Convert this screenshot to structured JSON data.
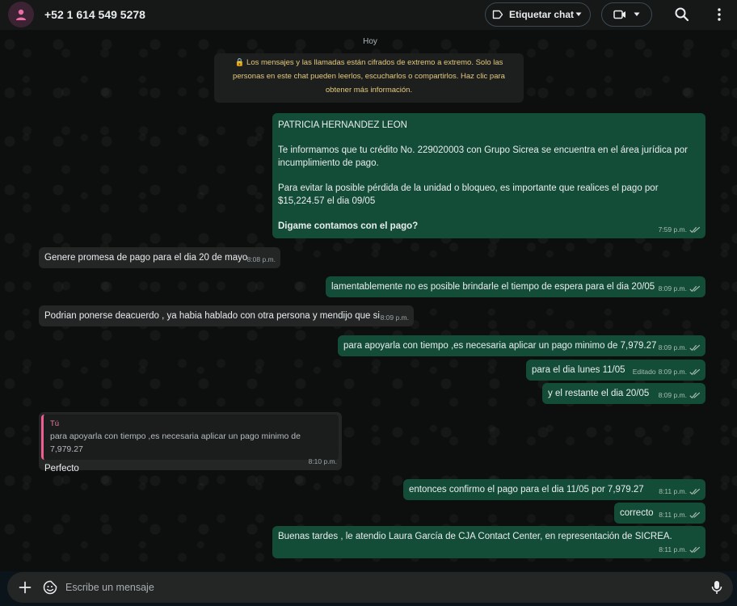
{
  "header": {
    "contact_name": "+52 1 614 549 5278",
    "label_button": "Etiquetar chat",
    "icons": [
      "person-icon",
      "label-icon",
      "chevron-down-icon",
      "video-camera-icon",
      "search-icon",
      "kebab-menu-icon"
    ]
  },
  "chat": {
    "day_chip": "Hoy",
    "encryption_notice": "🔒 Los mensajes y las llamadas están cifrados de extremo a extremo. Solo las personas en este chat pueden leerlos, escucharlos o compartirlos. Haz clic para obtener más información.",
    "messages": [
      {
        "direction": "out",
        "paragraphs": [
          "PATRICIA HERNANDEZ LEON",
          "Te informamos que tu crédito No. 229020003 con Grupo Sicrea se encuentra en el área jurídica por incumplimiento de pago.",
          "Para evitar la posible pérdida de la unidad o bloqueo, es importante que realices el pago  por $15,224.57 el dia 09/05",
          "Digame contamos con el pago?"
        ],
        "time": "7:59 p.m."
      },
      {
        "direction": "in",
        "text": "Genere promesa de pago para el dia 20 de mayo",
        "time": "8:08 p.m."
      },
      {
        "direction": "out",
        "text": "lamentablemente no es posible brindarle el tiempo de espera para el dia 20/05",
        "time": "8:09 p.m."
      },
      {
        "direction": "in",
        "text": "Podrian ponerse deacuerdo , ya habia hablado con otra persona y mendijo que si",
        "time": "8:09 p.m."
      },
      {
        "direction": "out",
        "text": "para apoyarla con tiempo ,es necesaria aplicar un pago minimo de 7,979.27",
        "time": "8:09 p.m."
      },
      {
        "direction": "out",
        "text": "para el dia lunes 11/05",
        "edited": "Editado",
        "time": "8:09 p.m."
      },
      {
        "direction": "out",
        "text": "y el restante  el dia  20/05",
        "time": "8:09 p.m."
      },
      {
        "direction": "in",
        "quote_author": "Tú",
        "quote_text": "para apoyarla con tiempo ,es necesaria aplicar un pago minimo de 7,979.27",
        "text": "Perfecto",
        "time": "8:10 p.m."
      },
      {
        "direction": "out",
        "text": "entonces confirmo el pago para el dia  11/05  por   7,979.27",
        "time": "8:11 p.m."
      },
      {
        "direction": "out",
        "text": "correcto",
        "time": "8:11 p.m."
      },
      {
        "direction": "out",
        "text": "Buenas tardes , le atendio  Laura García de CJA Contact Center, en representación de SICREA.",
        "time": "8:11 p.m."
      }
    ]
  },
  "composer": {
    "placeholder": "Escribe un mensaje",
    "icons": [
      "plus-icon",
      "sticker-icon",
      "microphone-icon"
    ]
  },
  "colors": {
    "outgoing_bubble": "#144d37",
    "incoming_bubble": "#242626",
    "header_bg": "#161717",
    "notice_text": "#e5c97c",
    "quote_accent": "#ef5d92"
  }
}
